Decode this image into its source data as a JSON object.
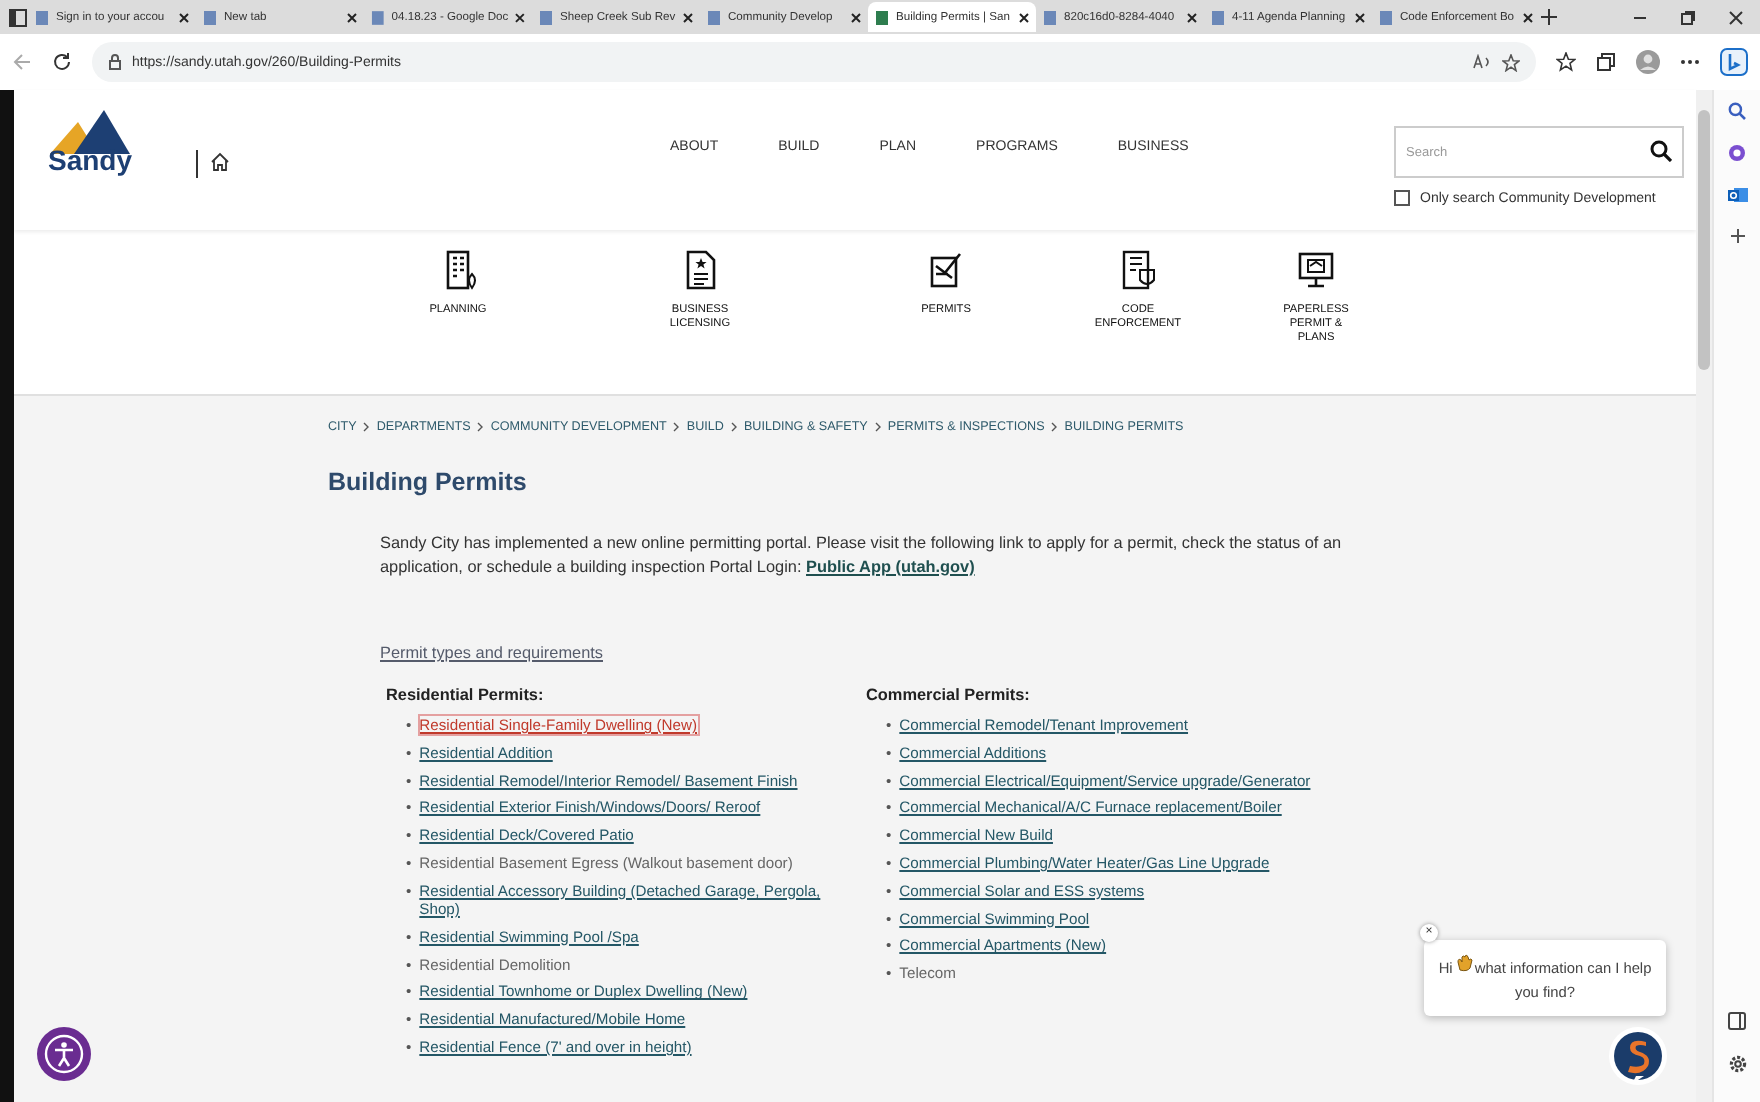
{
  "browser": {
    "tabs": [
      {
        "title": "Sign in to your accou",
        "selected": false
      },
      {
        "title": "New tab",
        "selected": false
      },
      {
        "title": "04.18.23 - Google Doc",
        "selected": false
      },
      {
        "title": "Sheep Creek Sub Rev",
        "selected": false
      },
      {
        "title": "Community Develop",
        "selected": false
      },
      {
        "title": "Building Permits | San",
        "selected": true
      },
      {
        "title": "820c16d0-8284-4040",
        "selected": false
      },
      {
        "title": "4-11 Agenda Planning",
        "selected": false
      },
      {
        "title": "Code Enforcement Bo",
        "selected": false
      }
    ],
    "address": "https://sandy.utah.gov/260/Building-Permits"
  },
  "header": {
    "logo_text": "Sandy",
    "nav": [
      "ABOUT",
      "BUILD",
      "PLAN",
      "PROGRAMS",
      "BUSINESS"
    ],
    "search": {
      "placeholder": "Search"
    },
    "search_option": {
      "label": "Only search Community Development",
      "checked": false
    }
  },
  "quick_links": [
    "PLANNING",
    "BUSINESS LICENSING",
    "PERMITS",
    "CODE ENFORCEMENT",
    "PAPERLESS PERMIT & PLANS"
  ],
  "breadcrumbs": [
    "CITY",
    "DEPARTMENTS",
    "COMMUNITY DEVELOPMENT",
    "BUILD",
    "BUILDING & SAFETY",
    "PERMITS & INSPECTIONS",
    "BUILDING PERMITS"
  ],
  "title": "Building Permits",
  "intro": {
    "text": "Sandy City has implemented a new online permitting portal. Please visit the following link to apply for a permit, check the status of an application, or schedule a building inspection Portal Login:",
    "link": "Public App (utah.gov)"
  },
  "section_link": "Permit types and requirements",
  "columns": [
    {
      "heading": "Residential Permits:",
      "marker": "•",
      "items": [
        {
          "label": "Residential Single-Family Dwelling (New)",
          "linked": true,
          "focused": true
        },
        {
          "label": "Residential Addition",
          "linked": true,
          "focused": false
        },
        {
          "label": "Residential Remodel/Interior Remodel/ Basement Finish",
          "linked": true,
          "focused": false
        },
        {
          "label": "Residential Exterior Finish/Windows/Doors/ Reroof",
          "linked": true,
          "focused": false
        },
        {
          "label": "Residential Deck/Covered Patio",
          "linked": true,
          "focused": false
        },
        {
          "label": "Residential Basement Egress (Walkout basement door)",
          "linked": false,
          "focused": false
        },
        {
          "label": "Residential Accessory Building (Detached Garage, Pergola, Shop)",
          "linked": true,
          "focused": false
        },
        {
          "label": "Residential Swimming Pool /Spa",
          "linked": true,
          "focused": false
        },
        {
          "label": "Residential Demolition",
          "linked": false,
          "focused": false
        },
        {
          "label": "Residential Townhome or Duplex Dwelling (New)",
          "linked": true,
          "focused": false
        },
        {
          "label": "Residential Manufactured/Mobile Home",
          "linked": true,
          "focused": false
        },
        {
          "label": "Residential Fence (7' and over in height)",
          "linked": true,
          "focused": false
        }
      ]
    },
    {
      "heading": "Commercial Permits:",
      "marker": "•",
      "items": [
        {
          "label": "Commercial Remodel/Tenant Improvement",
          "linked": true,
          "focused": false
        },
        {
          "label": "Commercial Additions",
          "linked": true,
          "focused": false
        },
        {
          "label": "Commercial Electrical/Equipment/Service upgrade/Generator",
          "linked": true,
          "focused": false
        },
        {
          "label": "Commercial Mechanical/A/C Furnace replacement/Boiler",
          "linked": true,
          "focused": false
        },
        {
          "label": "Commercial New Build",
          "linked": true,
          "focused": false
        },
        {
          "label": "Commercial Plumbing/Water Heater/Gas Line Upgrade",
          "linked": true,
          "focused": false
        },
        {
          "label": "Commercial Solar and ESS systems",
          "linked": true,
          "focused": false
        },
        {
          "label": "Commercial Swimming Pool",
          "linked": true,
          "focused": false
        },
        {
          "label": "Commercial Apartments (New)",
          "linked": true,
          "focused": false
        },
        {
          "label": "Telecom",
          "linked": false,
          "focused": false
        }
      ]
    }
  ],
  "chat": {
    "close": "×",
    "greeting": "Hi",
    "message": "what information can I help you find?"
  }
}
